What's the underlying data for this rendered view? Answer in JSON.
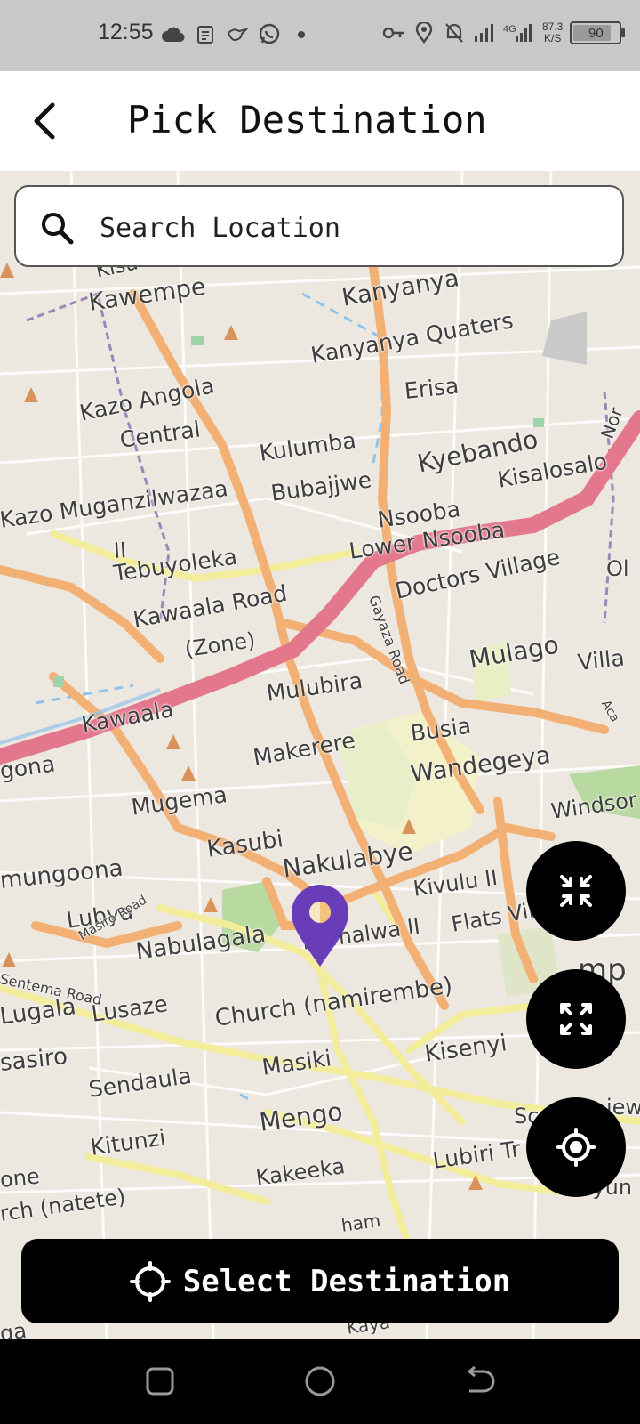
{
  "status_bar": {
    "time": "12:55",
    "network_type": "4G",
    "speed_value": "87.3",
    "speed_unit": "K/S",
    "battery_level": "90",
    "left_icons": [
      "cloud-icon",
      "notes-icon",
      "bird-icon",
      "whatsapp-icon",
      "dot-icon"
    ],
    "right_icons": [
      "key-icon",
      "location-icon",
      "mute-icon",
      "signal-icon",
      "signal-4g-icon"
    ]
  },
  "header": {
    "title": "Pick Destination",
    "back_icon": "chevron-left-icon"
  },
  "search": {
    "placeholder": "Search Location",
    "value": "",
    "icon": "search-icon"
  },
  "map": {
    "marker_color": "#6a3db8",
    "labels": [
      "Kawempe",
      "Kanyanya",
      "Kanyanya Quaters",
      "Erisa",
      "Kazo Angola",
      "Central",
      "Kulumba",
      "Kyebando",
      "Bubajjwe",
      "Kisalosalo",
      "Nsooba",
      "Kazo Muganzilwazaa",
      "II",
      "Lower Nsooba",
      "Tebuyoleka",
      "Doctors Village",
      "Kawaala Road",
      "(Zone)",
      "Gayaza Road",
      "Mulago",
      "Mulubira",
      "Busia",
      "Kawaala",
      "Makerere",
      "Wandegeya",
      "Mugema",
      "Windsor",
      "Kasubi",
      "mungoona",
      "Nakulabye",
      "Kivulu II",
      "Lubya",
      "Masiro Road",
      "Flats Villages",
      "Namalwa II",
      "Nabulagala",
      "Sentema Road",
      "Lugala",
      "Lusaze",
      "Church (namirembe)",
      "Kisenyi",
      "sasiro",
      "Sendaula",
      "Masiki",
      "Mengo",
      "Kitunzi",
      "Lubiri Tr",
      "Kakeeka",
      "rch (natete)",
      "gona",
      "Villa",
      "Ol",
      "Byun",
      "iew",
      "Sc",
      "mp",
      "Kisu",
      "Kaya",
      "ham",
      "ga",
      "one",
      "Nor",
      "Aca"
    ]
  },
  "controls": {
    "collapse_icon": "collapse-arrows-icon",
    "expand_icon": "expand-arrows-icon",
    "my_location_icon": "my-location-icon"
  },
  "action": {
    "label": "Select Destination",
    "icon": "crosshair-icon"
  },
  "nav_bar": {
    "keys": [
      "recents-square-icon",
      "home-circle-icon",
      "back-arrow-icon"
    ]
  }
}
